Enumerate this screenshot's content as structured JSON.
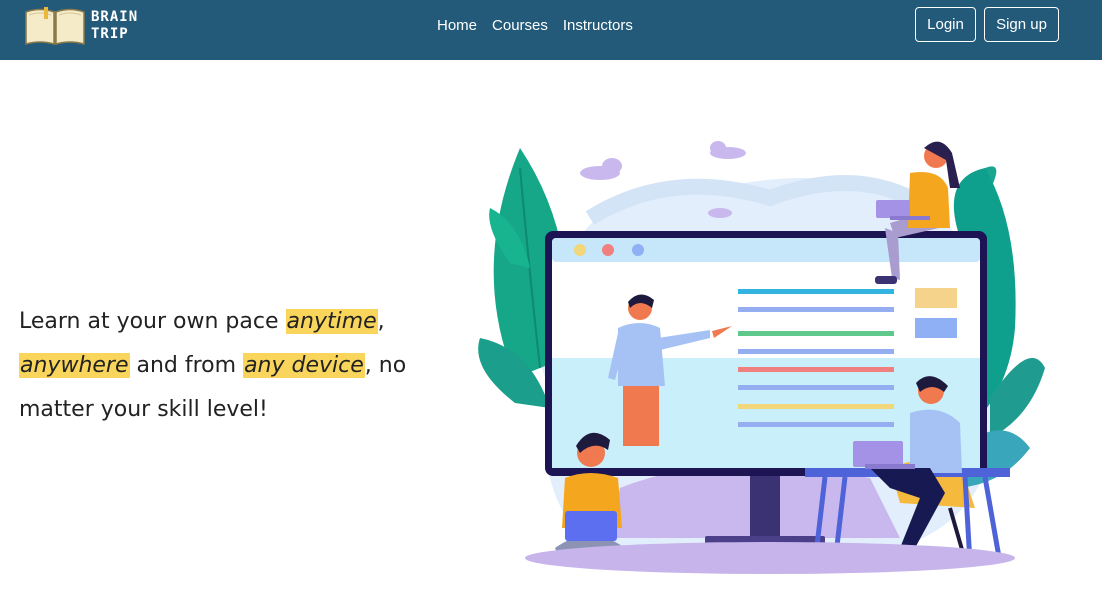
{
  "brand": {
    "line1": "BRAIN",
    "line2": "TRIP"
  },
  "nav": {
    "home": "Home",
    "courses": "Courses",
    "instructors": "Instructors"
  },
  "auth": {
    "login": "Login",
    "signup": "Sign up"
  },
  "hero": {
    "t1": "Learn at your own pace ",
    "h1": "anytime",
    "t2": ",",
    "h2": "anywhere",
    "t3": " and from ",
    "h3": "any device",
    "t4": ", no matter your skill level!"
  },
  "colors": {
    "navbar": "#235a79",
    "highlight": "#f9d65b",
    "text": "#222222"
  },
  "icons": {
    "logo": "open-book-icon"
  }
}
